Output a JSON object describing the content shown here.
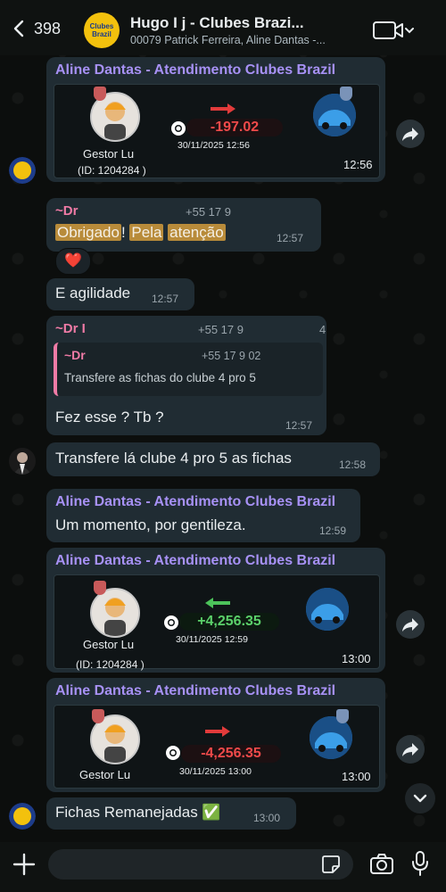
{
  "header": {
    "back_count": "398",
    "avatar_text": "Clubes Brazil",
    "title": "Hugo I          j - Clubes Brazi...",
    "subtitle": "00079 Patrick Ferreira, Aline Dantas -..."
  },
  "messages": {
    "m1": {
      "sender": "Aline Dantas - Atendimento Clubes Brazil",
      "name": "Gestor Lu",
      "id": "(ID: 1204284 )",
      "amount": "-197.02",
      "date": "30/11/2025 12:56",
      "time": "12:56"
    },
    "m2": {
      "sender": "~Dr",
      "phone": "+55 17 9",
      "word1": "Obrigado",
      "excl": "!",
      "word2": "Pela",
      "word3": "atenção",
      "time": "12:57",
      "reaction": "❤️"
    },
    "m3": {
      "text": "E agilidade",
      "time": "12:57"
    },
    "m4": {
      "sender": "~Dr I",
      "phone": "+55 17 9",
      "suffix": "4",
      "quote_sender": "~Dr",
      "quote_phone": "+55 17 9 02",
      "quote_text": "Transfere as fichas do clube 4 pro 5",
      "text": "Fez esse ? Tb ?",
      "time": "12:57"
    },
    "m5": {
      "text": "Transfere lá clube 4 pro 5 as fichas",
      "time": "12:58"
    },
    "m6": {
      "sender": "Aline Dantas - Atendimento Clubes Brazil",
      "text": "Um momento, por gentileza.",
      "time": "12:59"
    },
    "m7": {
      "sender": "Aline Dantas - Atendimento Clubes Brazil",
      "name": "Gestor Lu",
      "id": "(ID: 1204284 )",
      "amount": "+4,256.35",
      "date": "30/11/2025 12:59",
      "time": "13:00"
    },
    "m8": {
      "sender": "Aline Dantas - Atendimento Clubes Brazil",
      "name": "Gestor Lu",
      "amount": "-4,256.35",
      "date": "30/11/2025 13:00",
      "time": "13:00"
    },
    "m9": {
      "text": "Fichas Remanejadas ✅",
      "time": "13:00"
    }
  },
  "colors": {
    "sender_purple": "#a791f5",
    "sender_pink": "#f07ba6",
    "negative": "#ef4a4a",
    "positive": "#5bd06a"
  }
}
